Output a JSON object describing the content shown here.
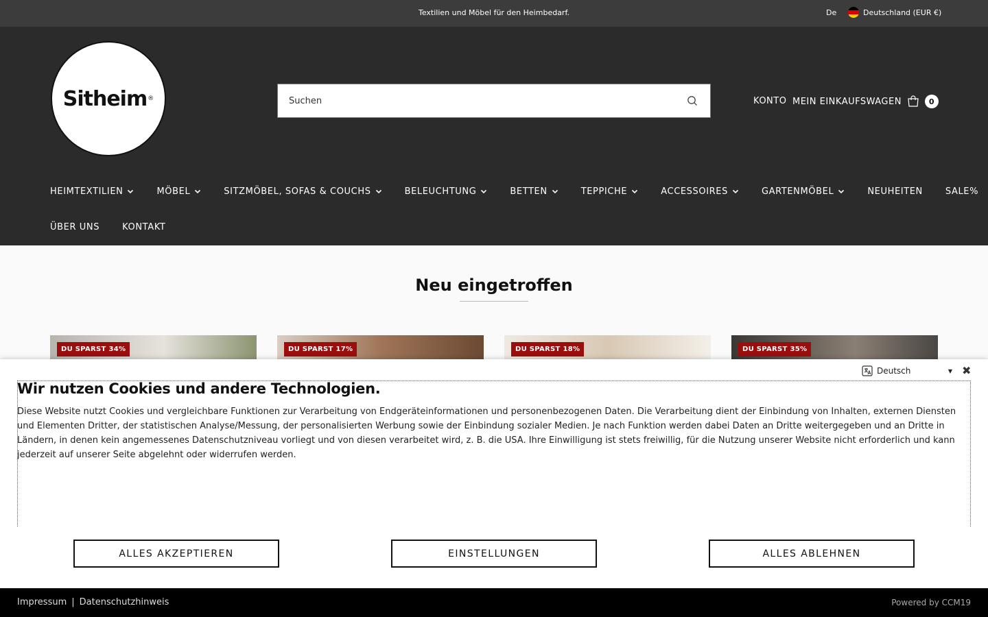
{
  "topbar": {
    "tagline": "Textilien und Möbel für den Heimbedarf.",
    "language": "De",
    "country": "Deutschland (EUR €)",
    "flag_colors": [
      "#000000",
      "#dd0000",
      "#ffce00"
    ]
  },
  "header": {
    "logo_text": "Sitheim",
    "logo_mark": "®",
    "search_placeholder": "Suchen",
    "account_label": "KONTO",
    "cart_label": "MEIN EINKAUFSWAGEN",
    "cart_count": "0"
  },
  "nav": {
    "row1": [
      {
        "label": "HEIMTEXTILIEN",
        "has_dropdown": true
      },
      {
        "label": "MÖBEL",
        "has_dropdown": true
      },
      {
        "label": "SITZMÖBEL, SOFAS & COUCHS",
        "has_dropdown": true
      },
      {
        "label": "BELEUCHTUNG",
        "has_dropdown": true
      },
      {
        "label": "BETTEN",
        "has_dropdown": true
      },
      {
        "label": "TEPPICHE",
        "has_dropdown": true
      },
      {
        "label": "ACCESSOIRES",
        "has_dropdown": true
      },
      {
        "label": "GARTENMÖBEL",
        "has_dropdown": true
      },
      {
        "label": "NEUHEITEN",
        "has_dropdown": false
      },
      {
        "label": "SALE%",
        "has_dropdown": false
      }
    ],
    "row2": [
      {
        "label": "ÜBER UNS",
        "has_dropdown": false
      },
      {
        "label": "KONTAKT",
        "has_dropdown": false
      }
    ]
  },
  "section": {
    "title": "Neu eingetroffen"
  },
  "products": [
    {
      "badge": "DU SPARST 34%"
    },
    {
      "badge": "DU SPARST 17%"
    },
    {
      "badge": "DU SPARST 18%"
    },
    {
      "badge": "DU SPARST 35%"
    }
  ],
  "cookie": {
    "language": "Deutsch",
    "title": "Wir nutzen Cookies und andere Technologien.",
    "text": "Diese Website nutzt Cookies und vergleichbare Funktionen zur Verarbeitung von Endgeräteinformationen und personenbezogenen Daten. Die Verarbeitung dient der Einbindung von Inhalten, externen Diensten und Elementen Dritter, der statistischen Analyse/Messung, der personalisierten Werbung sowie der Einbindung sozialer Medien. Je nach Funktion werden dabei Daten an Dritte weitergegeben und an Dritte in Ländern, in denen kein angemessenes Datenschutzniveau vorliegt und von diesen verarbeitet wird, z. B. die USA. Ihre Einwilligung ist stets freiwillig, für die Nutzung unserer Website nicht erforderlich und kann jederzeit auf unserer Seite abgelehnt oder widerrufen werden.",
    "accept_label": "ALLES AKZEPTIEREN",
    "settings_label": "EINSTELLUNGEN",
    "reject_label": "ALLES ABLEHNEN"
  },
  "footer": {
    "impressum": "Impressum",
    "separator": "|",
    "privacy": "Datenschutzhinweis",
    "powered": "Powered by CCM19"
  }
}
